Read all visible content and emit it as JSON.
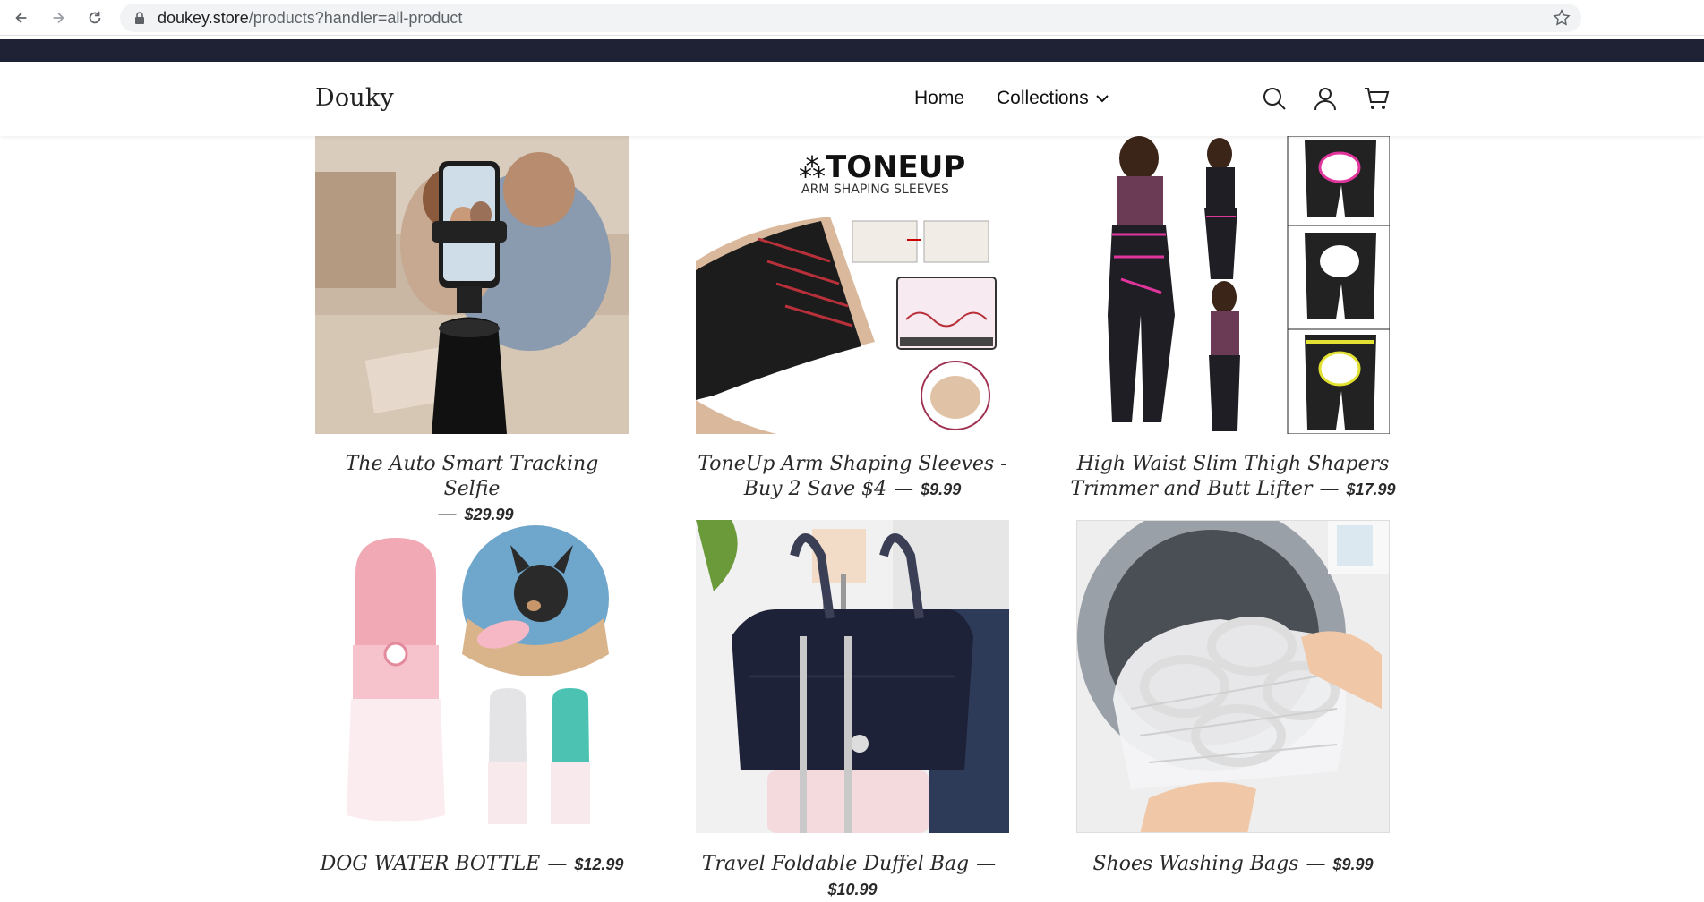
{
  "browser": {
    "url_domain": "doukey.store",
    "url_path": "/products?handler=all-product"
  },
  "header": {
    "logo": "Douky",
    "nav": {
      "home": "Home",
      "collections": "Collections"
    },
    "icons": [
      "search-icon",
      "account-icon",
      "cart-icon"
    ]
  },
  "products": [
    {
      "title": "The Auto Smart Tracking Selfie",
      "price": "$29.99"
    },
    {
      "title": "ToneUp Arm Shaping Sleeves - Buy 2 Save $4",
      "price": "$9.99"
    },
    {
      "title": "High Waist Slim Thigh Shapers Trimmer and Butt Lifter",
      "price": "$17.99"
    },
    {
      "title": "DOG WATER BOTTLE",
      "price": "$12.99"
    },
    {
      "title": "Travel Foldable Duffel Bag",
      "price": "$10.99"
    },
    {
      "title": "Shoes Washing Bags",
      "price": "$9.99"
    }
  ],
  "image_text": {
    "toneup_brand": "TONEUP",
    "toneup_sub": "ARM SHAPING SLEEVES"
  },
  "colors": {
    "announcement_bar": "#1f2135",
    "text": "#222222"
  }
}
